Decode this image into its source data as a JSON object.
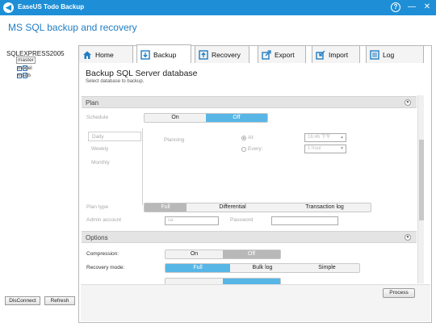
{
  "window": {
    "title": "EaseUS Todo Backup",
    "help": "?",
    "minimize": "—",
    "close": "✕"
  },
  "header": {
    "app_title": "MS SQL backup and recovery"
  },
  "tree": {
    "root": "SQLEXPRESS2005",
    "items": [
      {
        "label": "master",
        "checked": true,
        "selected": true
      },
      {
        "label": "model",
        "checked": false,
        "selected": false
      },
      {
        "label": "msdb",
        "checked": false,
        "selected": false
      }
    ]
  },
  "left_buttons": {
    "disconnect": "DisConnect",
    "refresh": "Refresh"
  },
  "tabs": [
    {
      "label": "Home",
      "icon": "home-icon"
    },
    {
      "label": "Backup",
      "icon": "backup-icon",
      "active": true
    },
    {
      "label": "Recovery",
      "icon": "recovery-icon"
    },
    {
      "label": "Export",
      "icon": "export-icon"
    },
    {
      "label": "Import",
      "icon": "import-icon"
    },
    {
      "label": "Log",
      "icon": "log-icon"
    }
  ],
  "panel": {
    "title": "Backup SQL Server database",
    "subtitle": "Select database to backup."
  },
  "plan": {
    "section_title": "Plan",
    "schedule_label": "Schedule",
    "schedule_on": "On",
    "schedule_off": "Off",
    "schedule_selected": "Off",
    "schedule_types": [
      "Daily",
      "Weekly",
      "Monthly"
    ],
    "planning_label": "Planning",
    "at_label": "At:",
    "at_value": "16:46 下午",
    "every_label": "Every:",
    "every_value": "1 hour",
    "plan_type_label": "Plan type",
    "plan_types": [
      "Full",
      "Differential",
      "Transaction log"
    ],
    "plan_type_selected": "Full",
    "admin_label": "Admin account",
    "admin_value": "sa",
    "password_label": "Password",
    "password_value": ""
  },
  "options": {
    "section_title": "Options",
    "compression_label": "Compression:",
    "compression_on": "On",
    "compression_off": "Off",
    "compression_selected": "Off",
    "recovery_label": "Recovery mode:",
    "recovery_modes": [
      "Full",
      "Bulk log",
      "Simple"
    ],
    "recovery_selected": "Full"
  },
  "footer": {
    "process_label": "Process"
  },
  "colors": {
    "title_bar": "#1e8fd6",
    "accent": "#57b6e6",
    "app_title": "#1e7cc4"
  }
}
